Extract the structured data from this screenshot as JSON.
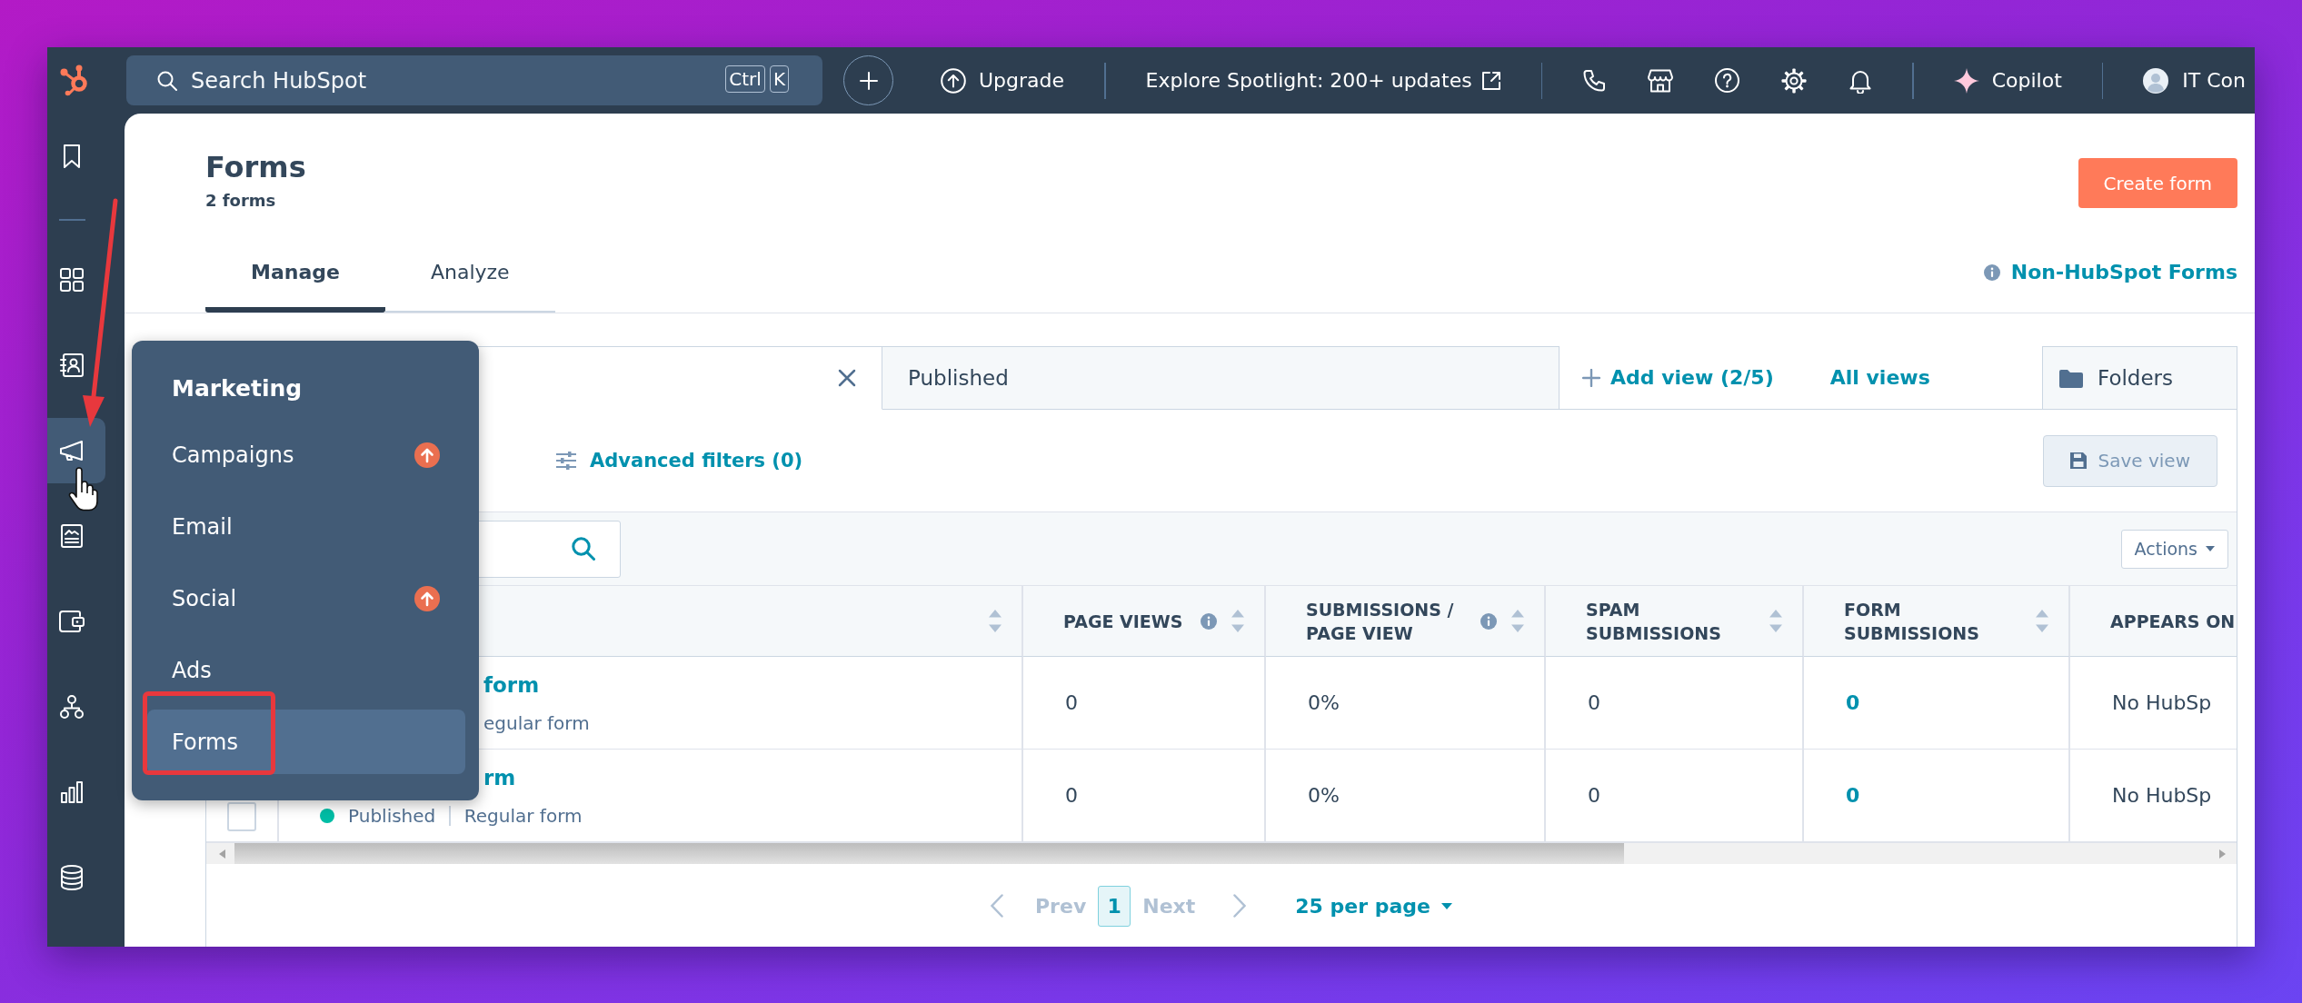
{
  "topbar": {
    "search": {
      "placeholder": "Search HubSpot",
      "shortcut": [
        "Ctrl",
        "K"
      ]
    },
    "upgrade": "Upgrade",
    "spotlight": "Explore Spotlight: 200+ updates",
    "copilot": "Copilot",
    "account": "IT Con"
  },
  "sidebar": {
    "items": [
      {
        "selected": false
      },
      {
        "selected": false
      },
      {
        "selected": false
      },
      {
        "selected": true
      },
      {
        "selected": false
      },
      {
        "selected": false
      },
      {
        "selected": false
      },
      {
        "selected": false
      },
      {
        "selected": false
      }
    ]
  },
  "page": {
    "title": "Forms",
    "count": "2 forms",
    "create_button": "Create form",
    "tabs": [
      {
        "label": "Manage",
        "selected": true
      },
      {
        "label": "Analyze",
        "selected": false
      }
    ],
    "info_link": "Non-HubSpot Forms"
  },
  "views": {
    "tabs": [
      {
        "selected": true,
        "closable": true
      },
      {
        "label": "Published",
        "selected": false,
        "closable": false
      }
    ],
    "add_view": "Add view (2/5)",
    "all_views": "All views",
    "folders": "Folders"
  },
  "filters": {
    "advanced": "Advanced filters (0)",
    "save_view": {
      "label": "Save view",
      "disabled": true
    }
  },
  "table": {
    "actions": "Actions",
    "columns": [
      {
        "kind": "name",
        "sortable": true,
        "info": false
      },
      {
        "kind": "text",
        "label": "PAGE VIEWS",
        "sortable": true,
        "info": true
      },
      {
        "kind": "text",
        "label": "SUBMISSIONS / PAGE VIEW",
        "sortable": true,
        "info": true
      },
      {
        "kind": "text",
        "label": "SPAM SUBMISSIONS",
        "sortable": true,
        "info": false
      },
      {
        "kind": "link",
        "label": "FORM SUBMISSIONS",
        "sortable": true,
        "info": false
      },
      {
        "kind": "text",
        "label": "APPEARS ON",
        "sortable": false,
        "info": false
      }
    ],
    "rows": [
      {
        "cells": [
          {
            "name": "form",
            "type": "egular form"
          },
          "0",
          "0%",
          "0",
          "0",
          "No HubSp"
        ]
      },
      {
        "checked": false,
        "cells": [
          {
            "name": "rm",
            "status": {
              "label": "Published",
              "color": "#00bda5"
            },
            "type": "Regular form"
          },
          "0",
          "0%",
          "0",
          "0",
          "No HubSp"
        ]
      }
    ]
  },
  "pagination": {
    "prev": {
      "label": "Prev",
      "disabled": true
    },
    "pages": [
      {
        "label": "1",
        "selected": true
      }
    ],
    "next": {
      "label": "Next",
      "disabled": true
    },
    "per_page": "25 per page"
  },
  "menu": {
    "title": "Marketing",
    "items": [
      {
        "label": "Campaigns",
        "upgrade": true,
        "selected": false
      },
      {
        "label": "Email",
        "upgrade": false,
        "selected": false
      },
      {
        "label": "Social",
        "upgrade": true,
        "selected": false
      },
      {
        "label": "Ads",
        "upgrade": false,
        "selected": false
      },
      {
        "label": "Forms",
        "upgrade": false,
        "selected": true
      }
    ]
  },
  "annotations": [
    {
      "kind": "arrow"
    },
    {
      "kind": "frame"
    },
    {
      "kind": "cursor"
    }
  ]
}
